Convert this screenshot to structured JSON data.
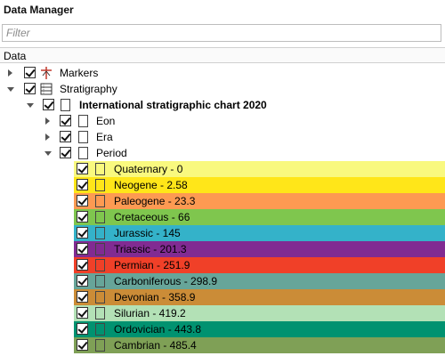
{
  "panel": {
    "title": "Data Manager"
  },
  "filter": {
    "placeholder": "Filter",
    "value": ""
  },
  "column": {
    "header": "Data"
  },
  "tree": {
    "markers": {
      "label": "Markers",
      "checked": true,
      "icon": "markers-icon"
    },
    "stratigraphy": {
      "label": "Stratigraphy",
      "checked": true,
      "icon": "stratigraphy-icon"
    },
    "chart": {
      "label": "International stratigraphic chart 2020",
      "checked": true
    },
    "eon": {
      "label": "Eon",
      "checked": true
    },
    "era": {
      "label": "Era",
      "checked": true
    },
    "period": {
      "label": "Period",
      "checked": true
    },
    "periods": [
      {
        "label": "Quaternary - 0",
        "color": "#f9f97f"
      },
      {
        "label": "Neogene - 2.58",
        "color": "#ffe619"
      },
      {
        "label": "Paleogene - 23.3",
        "color": "#fd9a52"
      },
      {
        "label": "Cretaceous - 66",
        "color": "#7fc64e"
      },
      {
        "label": "Jurassic - 145",
        "color": "#34b2c9"
      },
      {
        "label": "Triassic - 201.3",
        "color": "#812b92"
      },
      {
        "label": "Permian - 251.9",
        "color": "#f04028"
      },
      {
        "label": "Carboniferous - 298.9",
        "color": "#67a599"
      },
      {
        "label": "Devonian - 358.9",
        "color": "#cb8c37"
      },
      {
        "label": "Silurian - 419.2",
        "color": "#b3e1b6"
      },
      {
        "label": "Ordovician - 443.8",
        "color": "#009270"
      },
      {
        "label": "Cambrian - 485.4",
        "color": "#7fa056"
      }
    ]
  }
}
